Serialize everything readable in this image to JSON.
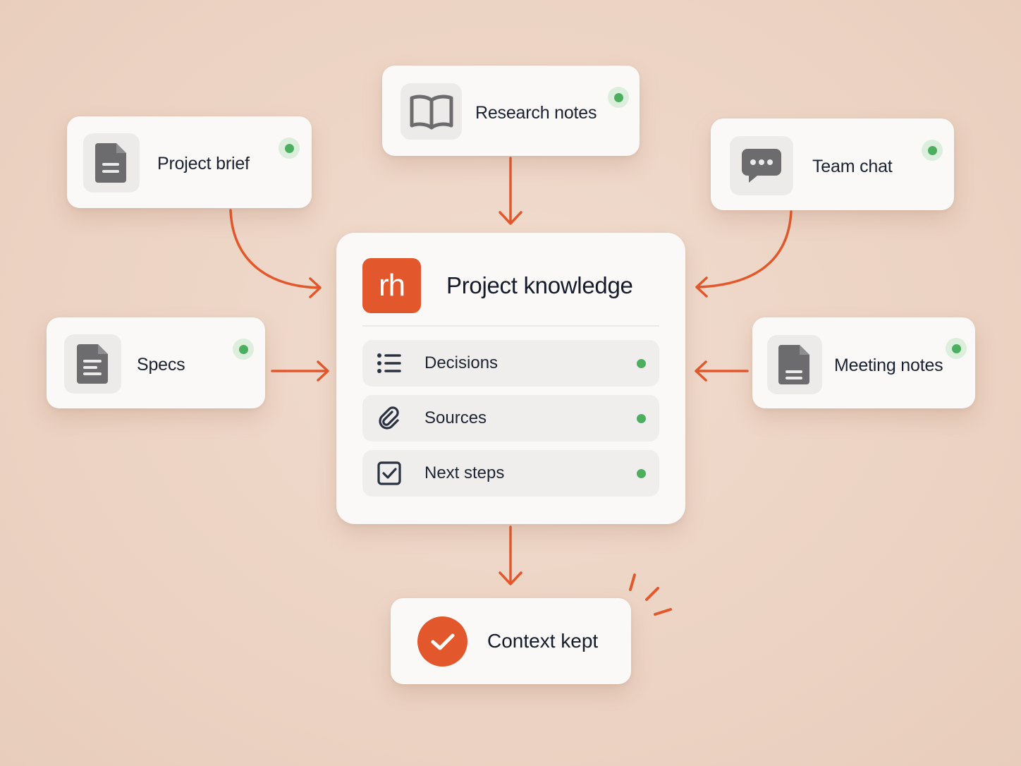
{
  "sources": {
    "project_brief": {
      "label": "Project brief",
      "icon": "document-icon",
      "status": "active"
    },
    "research_notes": {
      "label": "Research notes",
      "icon": "open-book-icon",
      "status": "active"
    },
    "team_chat": {
      "label": "Team chat",
      "icon": "chat-bubble-icon",
      "status": "active"
    },
    "specs": {
      "label": "Specs",
      "icon": "document-lines-icon",
      "status": "active"
    },
    "meeting_notes": {
      "label": "Meeting notes",
      "icon": "document-icon",
      "status": "active"
    }
  },
  "hub": {
    "logo_text": "rh",
    "title": "Project knowledge",
    "rows": [
      {
        "label": "Decisions",
        "icon": "list-icon",
        "status": "active"
      },
      {
        "label": "Sources",
        "icon": "paperclip-icon",
        "status": "active"
      },
      {
        "label": "Next steps",
        "icon": "checkbox-icon",
        "status": "active"
      }
    ]
  },
  "result": {
    "label": "Context kept",
    "icon": "checkmark-circle-icon"
  },
  "colors": {
    "accent": "#e2582c",
    "status_green": "#4caf60",
    "background": "#ecd3c3",
    "card": "#faf9f8",
    "icon_gray": "#6c6c6e"
  }
}
